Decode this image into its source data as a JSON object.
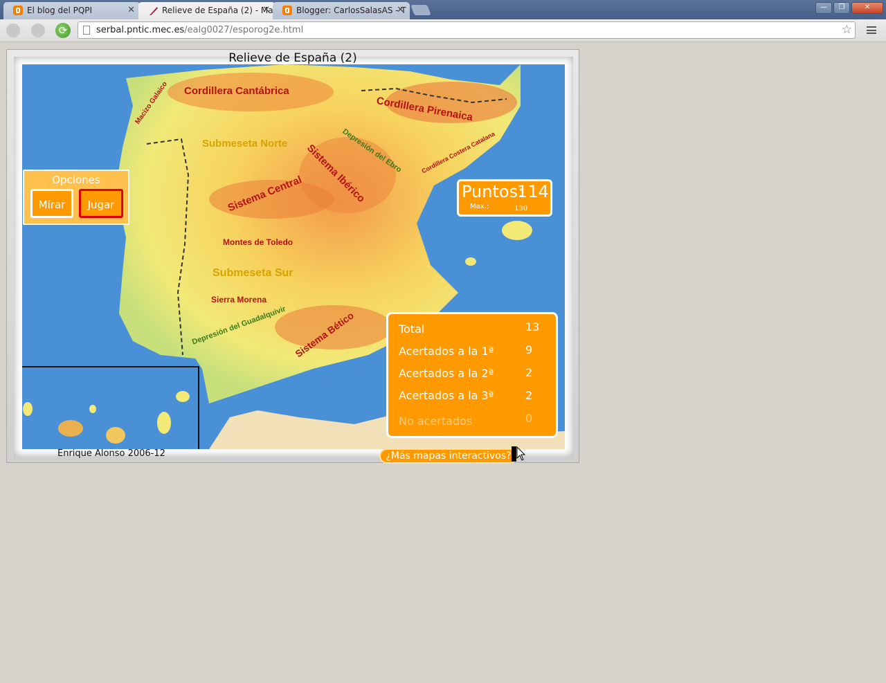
{
  "browser": {
    "tabs": [
      {
        "title": "El blog del PQPI",
        "icon": "blogger-icon",
        "active": false
      },
      {
        "title": "Relieve de España (2) - Ma",
        "icon": "quill-icon",
        "active": true
      },
      {
        "title": "Blogger: CarlosSalasAS - T",
        "icon": "blogger-icon",
        "active": false
      }
    ],
    "url_host": "serbal.pntic.mec.es",
    "url_path": "/ealg0027/esporog2e.html"
  },
  "app": {
    "title": "Relieve de España (2)",
    "credit": "Enrique Alonso 2006-12",
    "more_maps": "¿Más mapas interactivos?"
  },
  "options": {
    "title": "Opciones",
    "mirar": "Mirar",
    "jugar": "Jugar"
  },
  "score": {
    "label": "Puntos:",
    "value": "114",
    "max_label": "Max.:",
    "max_value": "130"
  },
  "stats": {
    "total_label": "Total",
    "total_value": "13",
    "first_label": "Acertados a la 1ª",
    "first_value": "9",
    "second_label": "Acertados a la 2ª",
    "second_value": "2",
    "third_label": "Acertados a la 3ª",
    "third_value": "2",
    "none_label": "No acertados",
    "none_value": "0"
  },
  "map_labels": {
    "cantabrica": "Cordillera Cantábrica",
    "pirenaica": "Cordillera Pirenaica",
    "galaico": "Macizo Galaico",
    "norte": "Submeseta Norte",
    "ebro": "Depresión del Ebro",
    "costera": "Cordillera Costera Catalana",
    "iberico": "Sistema Ibérico",
    "central": "Sistema Central",
    "toledo": "Montes de Toledo",
    "sur": "Submeseta Sur",
    "morena": "Sierra Morena",
    "guadalquivir": "Depresión del Guadalquivir",
    "betico": "Sistema Bético"
  },
  "colors": {
    "sea": "#4a90d6",
    "panel_orange": "#ff9900",
    "options_bg": "#ffc04d"
  }
}
